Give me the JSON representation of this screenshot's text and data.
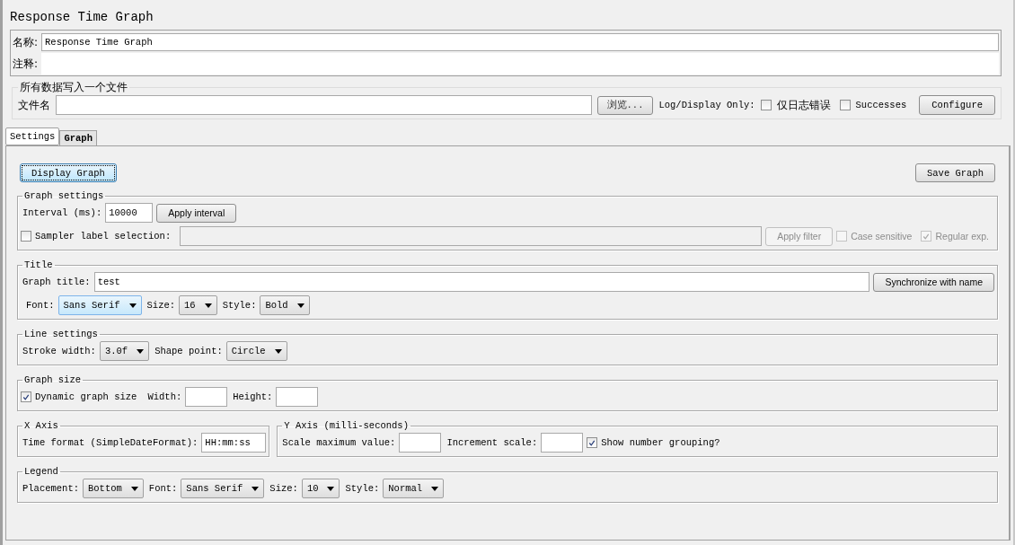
{
  "title": "Response Time Graph",
  "name_field": {
    "label": "名称:",
    "value": "Response Time Graph"
  },
  "comment_field": {
    "label": "注释:"
  },
  "file_section": {
    "legend": "所有数据写入一个文件",
    "label": "文件名",
    "browse": "浏览...",
    "log_label": "Log/Display Only:",
    "options": [
      {
        "label": "仅日志错误",
        "checked": false
      },
      {
        "label": "Successes",
        "checked": false
      }
    ],
    "configure": "Configure"
  },
  "tabs": [
    {
      "label": "Settings",
      "selected": true
    },
    {
      "label": "Graph",
      "selected": false
    }
  ],
  "display_button": "Display Graph",
  "save_button": "Save Graph",
  "group_rows": [
    [
      {
        "legend": "Graph settings",
        "rows": [
          [
            {
              "kind": "label",
              "text": "Interval (ms):"
            },
            {
              "kind": "input",
              "value": "10000",
              "disabled": false
            },
            {
              "kind": "button",
              "label": "Apply interval",
              "disabled": false
            }
          ],
          [
            {
              "kind": "checkbox",
              "label": "Sampler label selection:",
              "checked": false,
              "disabled": false
            },
            {
              "kind": "wide-input",
              "disabled": true
            },
            {
              "kind": "button",
              "label": "Apply filter",
              "disabled": true
            },
            {
              "kind": "checkbox",
              "label": "Case sensitive",
              "checked": false,
              "disabled": true
            },
            {
              "kind": "checkbox",
              "label": "Regular exp.",
              "checked": true,
              "disabled": true
            }
          ]
        ]
      }
    ],
    [
      {
        "legend": "Title",
        "rows": [
          [
            {
              "kind": "label",
              "text": "Graph title:"
            },
            {
              "kind": "wide-input",
              "value": "test",
              "disabled": false
            },
            {
              "kind": "button",
              "label": "Synchronize with name",
              "disabled": false
            }
          ],
          [
            {
              "kind": "label",
              "text": "Font:"
            },
            {
              "kind": "select",
              "value": "Sans Serif",
              "focused": true
            },
            {
              "kind": "label",
              "text": "Size:"
            },
            {
              "kind": "select",
              "value": "16",
              "focused": false
            },
            {
              "kind": "label",
              "text": "Style:"
            },
            {
              "kind": "select",
              "value": "Bold",
              "focused": false
            }
          ]
        ]
      }
    ],
    [
      {
        "legend": "Line settings",
        "rows": [
          [
            {
              "kind": "label",
              "text": "Stroke width:"
            },
            {
              "kind": "select",
              "value": "3.0f",
              "focused": false
            },
            {
              "kind": "label",
              "text": "Shape point:"
            },
            {
              "kind": "select",
              "value": "Circle",
              "focused": false
            }
          ]
        ]
      }
    ],
    [
      {
        "legend": "Graph size",
        "rows": [
          [
            {
              "kind": "checkbox",
              "label": "Dynamic graph size",
              "checked": true,
              "disabled": false
            },
            {
              "kind": "label",
              "text": "Width:"
            },
            {
              "kind": "input",
              "disabled": false
            },
            {
              "kind": "label",
              "text": "Height:"
            },
            {
              "kind": "input",
              "disabled": false
            }
          ]
        ]
      }
    ],
    [
      {
        "legend": "X Axis",
        "rows": [
          [
            {
              "kind": "label",
              "text": "Time format (SimpleDateFormat):"
            },
            {
              "kind": "input",
              "value": "HH:mm:ss",
              "disabled": false
            }
          ]
        ]
      },
      {
        "legend": "Y Axis (milli-seconds)",
        "rows": [
          [
            {
              "kind": "label",
              "text": "Scale maximum value:"
            },
            {
              "kind": "input",
              "disabled": false
            },
            {
              "kind": "label",
              "text": "Increment scale:"
            },
            {
              "kind": "input",
              "disabled": false
            },
            {
              "kind": "checkbox",
              "label": "Show number grouping?",
              "checked": true,
              "disabled": false
            }
          ]
        ]
      }
    ],
    [
      {
        "legend": "Legend",
        "rows": [
          [
            {
              "kind": "label",
              "text": "Placement:"
            },
            {
              "kind": "select",
              "value": "Bottom",
              "focused": false
            },
            {
              "kind": "label",
              "text": "Font:"
            },
            {
              "kind": "select",
              "value": "Sans Serif",
              "focused": false
            },
            {
              "kind": "label",
              "text": "Size:"
            },
            {
              "kind": "select",
              "value": "10",
              "focused": false
            },
            {
              "kind": "label",
              "text": "Style:"
            },
            {
              "kind": "select",
              "value": "Normal",
              "focused": false
            }
          ]
        ]
      }
    ]
  ]
}
